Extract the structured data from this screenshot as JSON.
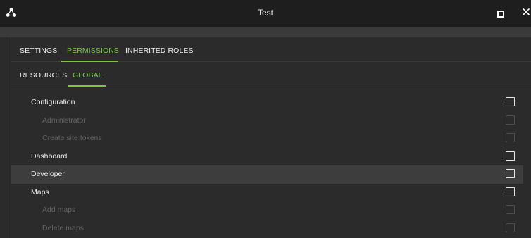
{
  "window": {
    "title": "Test"
  },
  "icons": {
    "app": "app-logo-icon",
    "maximize": "maximize-icon",
    "close": "close-icon"
  },
  "colors": {
    "accent": "#7ac943",
    "background": "#2b2b2b",
    "titlebar": "#1e1e1e"
  },
  "tabs": [
    {
      "label": "SETTINGS",
      "active": false
    },
    {
      "label": "PERMISSIONS",
      "active": true
    },
    {
      "label": "INHERITED ROLES",
      "active": false
    }
  ],
  "subtabs": [
    {
      "label": "RESOURCES",
      "active": false
    },
    {
      "label": "GLOBAL",
      "active": true
    }
  ],
  "permissions": [
    {
      "label": "Configuration",
      "level": "parent",
      "checked": false
    },
    {
      "label": "Administrator",
      "level": "child",
      "checked": false
    },
    {
      "label": "Create site tokens",
      "level": "child",
      "checked": false
    },
    {
      "label": "Dashboard",
      "level": "parent",
      "checked": false
    },
    {
      "label": "Developer",
      "level": "parent",
      "checked": false,
      "highlighted": true
    },
    {
      "label": "Maps",
      "level": "parent",
      "checked": false
    },
    {
      "label": "Add maps",
      "level": "child",
      "checked": false
    },
    {
      "label": "Delete maps",
      "level": "child",
      "checked": false
    }
  ]
}
